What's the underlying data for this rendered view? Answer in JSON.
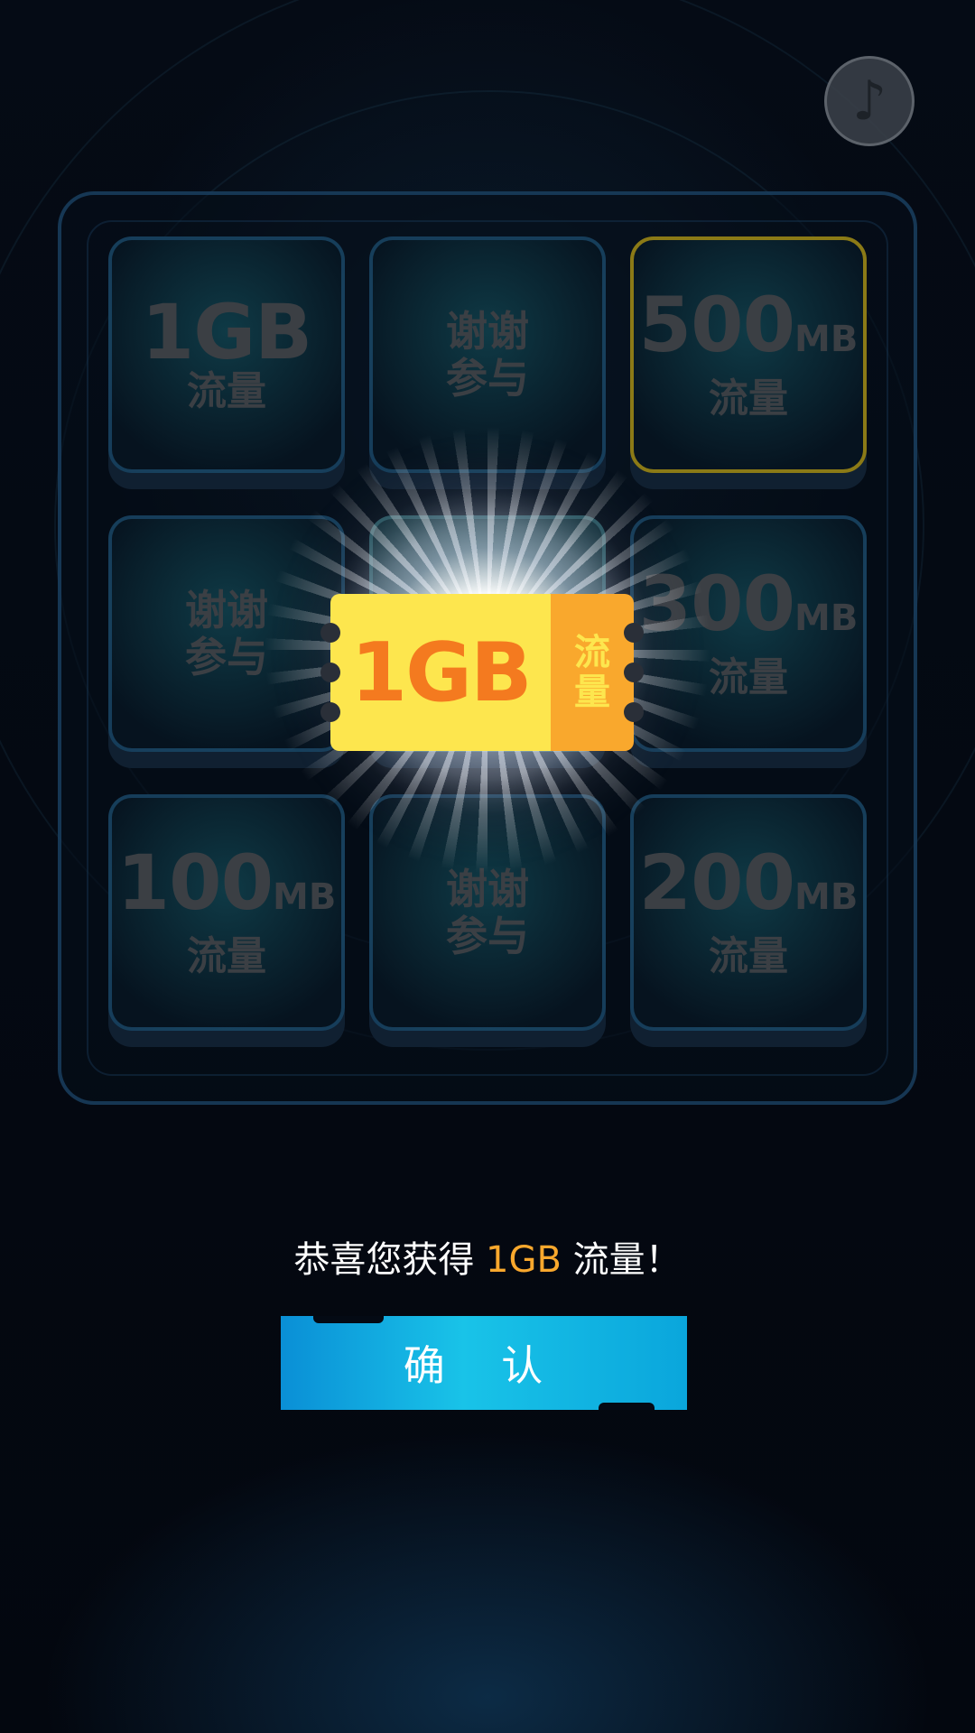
{
  "music_button": {
    "icon": "music-note-icon",
    "glyph": "♪"
  },
  "prizes": [
    {
      "big": "1GB",
      "unit": "",
      "sub": "流量"
    },
    {
      "line1": "谢谢",
      "line2": "参与"
    },
    {
      "big": "500",
      "unit": "MB",
      "sub": "流量"
    },
    {
      "line1": "谢谢",
      "line2": "参与"
    },
    {
      "center": true
    },
    {
      "big": "300",
      "unit": "MB",
      "sub": "流量"
    },
    {
      "big": "100",
      "unit": "MB",
      "sub": "流量"
    },
    {
      "line1": "谢谢",
      "line2": "参与"
    },
    {
      "big": "200",
      "unit": "MB",
      "sub": "流量"
    }
  ],
  "ticket": {
    "amount": "1GB",
    "label_line1": "流",
    "label_line2": "量"
  },
  "result": {
    "prefix": "恭喜您获得 ",
    "amount": "1GB",
    "suffix": " 流量！"
  },
  "confirm_button": {
    "label": "确 认"
  },
  "colors": {
    "accent": "#f9a82d",
    "ticket_yellow": "#fde64e",
    "button_blue": "#19c3e8"
  }
}
